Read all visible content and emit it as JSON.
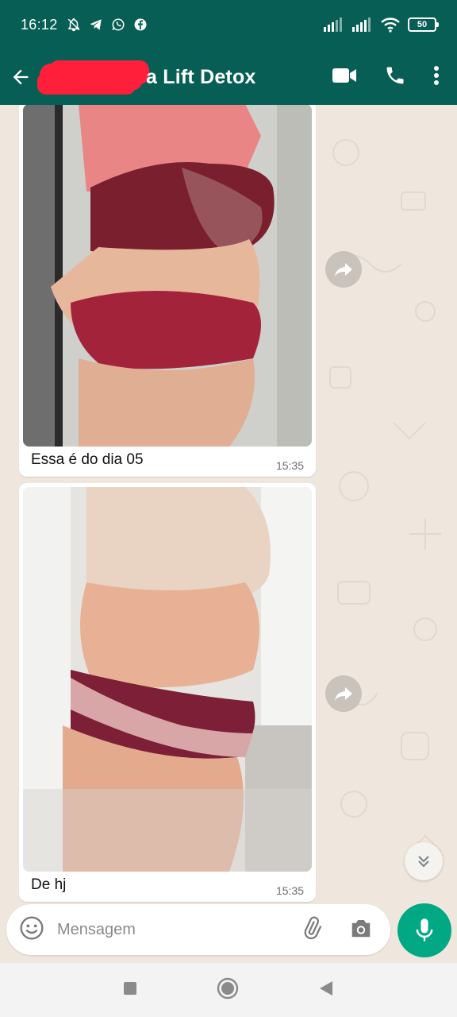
{
  "status_bar": {
    "time": "16:12",
    "battery": "50",
    "left_icons": [
      "bell-off-icon",
      "telegram-icon",
      "whatsapp-icon",
      "facebook-icon"
    ],
    "right_icons": [
      "signal-1-icon",
      "signal-2-icon",
      "wifi-icon",
      "battery-icon"
    ]
  },
  "header": {
    "title": "a Lift Detox",
    "actions": [
      "video-call-icon",
      "phone-icon",
      "more-vert-icon"
    ],
    "colors": {
      "bar": "#075e54",
      "redaction": "#ff1f3a"
    }
  },
  "messages": [
    {
      "caption": "Essa é do dia 05",
      "time": "15:35",
      "photo_colors": {
        "wall": "#cfcfcc",
        "top": "#e98585",
        "bra": "#7a1f2e",
        "skin": "#e7b79c",
        "panty": "#a3243a"
      }
    },
    {
      "caption": "De hj",
      "time": "15:35",
      "photo_colors": {
        "wall": "#e5e4e0",
        "bra": "#e9d3c3",
        "skin": "#e8b196",
        "panty": "#7d1f36",
        "lace": "#d9a6a8"
      }
    }
  ],
  "composer": {
    "placeholder": "Mensagem",
    "icons": [
      "emoji-icon",
      "attach-icon",
      "camera-icon"
    ],
    "mic_color": "#00a884"
  },
  "navbar": {
    "icons": [
      "recents-icon",
      "home-icon",
      "back-triangle-icon"
    ]
  }
}
